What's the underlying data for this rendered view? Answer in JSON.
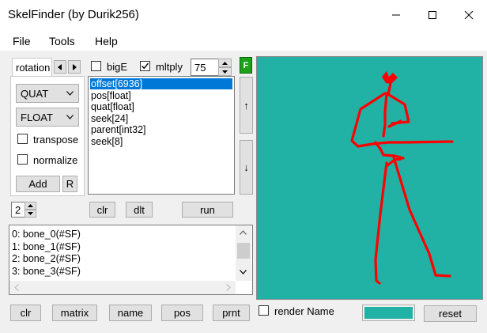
{
  "window": {
    "title": "SkelFinder (by Durik256)"
  },
  "menu": {
    "file": "File",
    "tools": "Tools",
    "help": "Help"
  },
  "left_panel": {
    "tab_label": "rotation",
    "quat_select": "QUAT",
    "float_select": "FLOAT",
    "transpose_label": "transpose",
    "normalize_label": "normalize",
    "add_button": "Add",
    "r_button": "R"
  },
  "options": {
    "bige_label": "bigE",
    "mltply_label": "mltply",
    "mltply_checked": true,
    "value": "75",
    "f_button": "F"
  },
  "fields_list": {
    "items": [
      "offset[6936]",
      "pos[float]",
      "quat[float]",
      "seek[24]",
      "parent[int32]",
      "seek[8]"
    ],
    "selected_index": 0
  },
  "scroll_buttons": {
    "up": "↑",
    "down": "↓"
  },
  "action_row": {
    "spinner_value": "2",
    "clr": "clr",
    "dlt": "dlt",
    "run": "run"
  },
  "bones_list": {
    "items": [
      "0: bone_0(#SF)",
      "1: bone_1(#SF)",
      "2: bone_2(#SF)",
      "3: bone_3(#SF)"
    ]
  },
  "bottom_bar": {
    "clr": "clr",
    "matrix": "matrix",
    "name": "name",
    "pos": "pos",
    "prnt": "prnt",
    "render_name_label": "render Name",
    "reset": "reset"
  },
  "preview": {
    "background": "#22b1a5",
    "bone_color": "#ff0000",
    "swatch_color": "#22b1a5"
  }
}
